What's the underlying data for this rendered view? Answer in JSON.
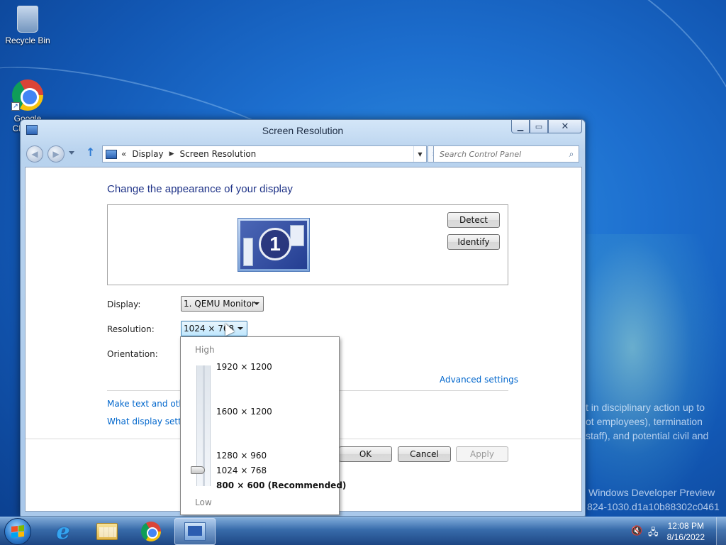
{
  "desktop": {
    "icons": [
      {
        "label": "Recycle Bin"
      },
      {
        "label": "Google Chrome"
      }
    ],
    "watermark_lines": [
      "t in disciplinary action up to",
      "ot employees), termination",
      "staff), and potential civil and",
      "Windows Developer Preview",
      "824-1030.d1a10b88302c0461"
    ]
  },
  "window": {
    "title": "Screen Resolution",
    "breadcrumb": [
      "Display",
      "Screen Resolution"
    ],
    "breadcrumb_prefix": "«",
    "search_placeholder": "Search Control Panel",
    "heading": "Change the appearance of your display",
    "monitor_number": "1",
    "buttons": {
      "detect": "Detect",
      "identify": "Identify",
      "ok": "OK",
      "cancel": "Cancel",
      "apply": "Apply"
    },
    "fields": {
      "display_label": "Display:",
      "display_value": "1. QEMU Monitor",
      "resolution_label": "Resolution:",
      "resolution_value": "1024 × 768",
      "orientation_label": "Orientation:"
    },
    "links": {
      "advanced": "Advanced settings",
      "make_text": "Make text and other items larger or smaller",
      "what_display": "What display settings should I choose?"
    }
  },
  "resolution_popup": {
    "high_label": "High",
    "low_label": "Low",
    "options": [
      {
        "label": "1920 × 1200",
        "recommended": false
      },
      {
        "label": "1600 × 1200",
        "recommended": false
      },
      {
        "label": "1280 × 960",
        "recommended": false
      },
      {
        "label": "1024 × 768",
        "recommended": false,
        "selected": true
      },
      {
        "label": "800 × 600 (Recommended)",
        "recommended": true
      }
    ]
  },
  "taskbar": {
    "time": "12:08 PM",
    "date": "8/16/2022",
    "pinned": [
      "internet-explorer",
      "windows-explorer",
      "google-chrome",
      "screen-resolution"
    ],
    "active": "screen-resolution"
  }
}
